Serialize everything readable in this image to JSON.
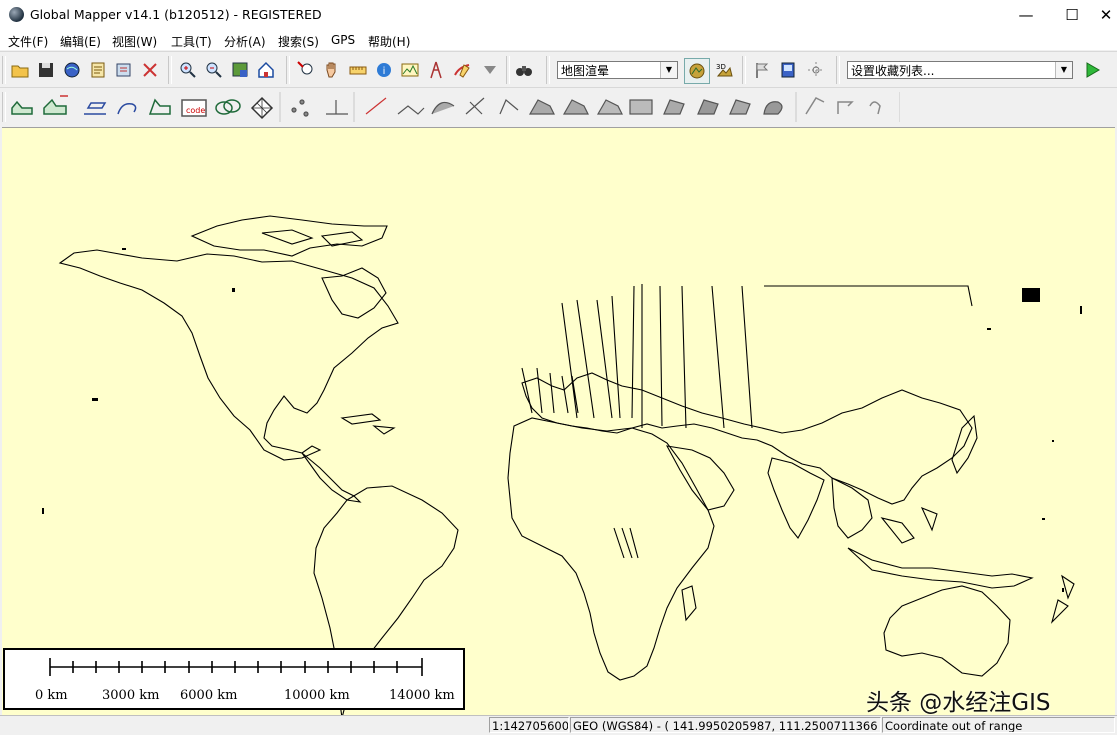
{
  "window": {
    "title": "Global Mapper v14.1 (b120512) - REGISTERED",
    "minimize_glyph": "—",
    "maximize_glyph": "☐",
    "close_glyph": "✕"
  },
  "menu": [
    "文件(F)",
    "编辑(E)",
    "视图(W)",
    "工具(T)",
    "分析(A)",
    "搜索(S)",
    "GPS",
    "帮助(H)"
  ],
  "toolbar1": {
    "buttons": [
      "open-icon",
      "save-icon",
      "globe-icon",
      "print-icon",
      "export-icon",
      "config-icon",
      "zoom-in-icon",
      "zoom-out-icon",
      "full-view-icon",
      "home-icon",
      "zoom-tool-icon",
      "pan-tool-icon",
      "measure-tool-icon",
      "info-tool-icon",
      "path-profile-icon",
      "tower-icon",
      "digitizer-icon",
      "feature-filter-icon",
      "binoculars-icon"
    ],
    "shader_select": "地图渲晕",
    "shader_buttons": [
      "layer-shade-icon",
      "3d-view-icon"
    ],
    "extra_buttons": [
      "flag-icon",
      "map-layout-icon",
      "gps-tracking-icon"
    ],
    "favorites_select": "设置收藏列表...",
    "run_label": "▶"
  },
  "toolbar2": {
    "buttons": [
      "edit-vertices-icon",
      "insert-vertex-icon",
      "move-feature-icon",
      "rotate-feature-icon",
      "create-line-icon",
      "coordinate-code-icon",
      "split-icon",
      "grid-icon",
      "move-point-icon",
      "draw-point-icon",
      "edit-line-icon",
      "smooth-line-icon",
      "clip-icon",
      "combine-icon",
      "reshape-icon",
      "union-icon",
      "intersect-icon",
      "difference-icon",
      "buffer-icon",
      "area-create-icon",
      "area-cut-icon",
      "area-join-icon",
      "area-shape-icon",
      "undo-icon",
      "redo-icon",
      "repeat-icon"
    ]
  },
  "scale_bar": {
    "labels": [
      "0 km",
      "3000 km",
      "6000 km",
      "10000 km",
      "14000 km"
    ]
  },
  "watermark": "头条 @水经注GIS",
  "status": {
    "scale": "1:142705600",
    "coords": "GEO (WGS84) - ( 141.9950205987, 111.2500711366 )",
    "message": "Coordinate out of range"
  }
}
